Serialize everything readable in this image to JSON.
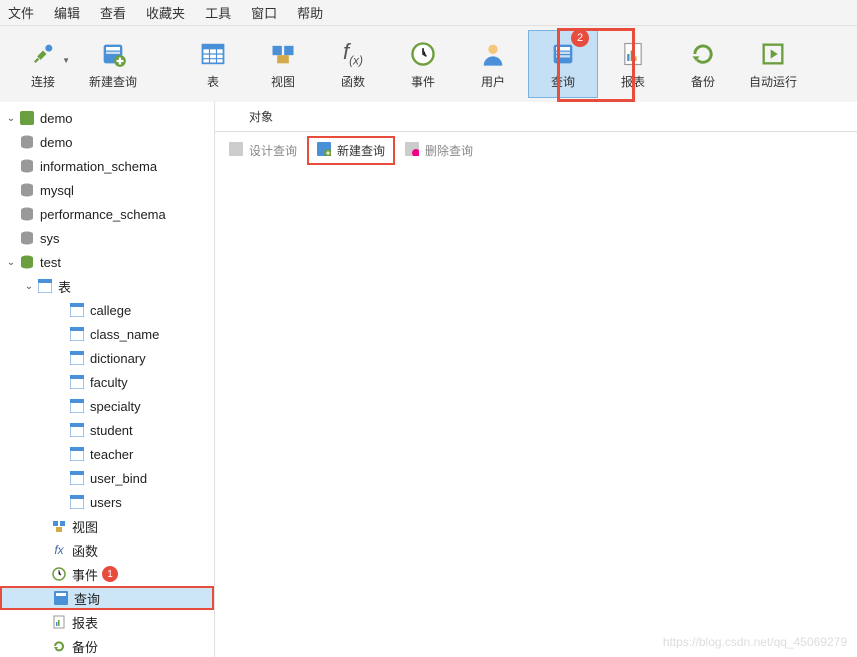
{
  "menu": {
    "items": [
      "文件",
      "编辑",
      "查看",
      "收藏夹",
      "工具",
      "窗口",
      "帮助"
    ]
  },
  "toolbar": {
    "connect": "连接",
    "newQuery": "新建查询",
    "table": "表",
    "view": "视图",
    "function": "函数",
    "event": "事件",
    "user": "用户",
    "query": "查询",
    "report": "报表",
    "backup": "备份",
    "autorun": "自动运行",
    "badge2": "2"
  },
  "tree": {
    "root": "demo",
    "databases": {
      "d0": "demo",
      "d1": "information_schema",
      "d2": "mysql",
      "d3": "performance_schema",
      "d4": "sys",
      "d5": "test"
    },
    "groups": {
      "tables": "表",
      "views": "视图",
      "functions": "函数",
      "events": "事件",
      "queries": "查询",
      "reports": "报表",
      "backups": "备份"
    },
    "tables": {
      "t0": "callege",
      "t1": "class_name",
      "t2": "dictionary",
      "t3": "faculty",
      "t4": "specialty",
      "t5": "student",
      "t6": "teacher",
      "t7": "user_bind",
      "t8": "users"
    },
    "badge1": "1"
  },
  "main": {
    "tab": "对象",
    "actions": {
      "design": "设计查询",
      "new": "新建查询",
      "delete": "删除查询"
    }
  },
  "watermark": "https://blog.csdn.net/qq_45069279"
}
